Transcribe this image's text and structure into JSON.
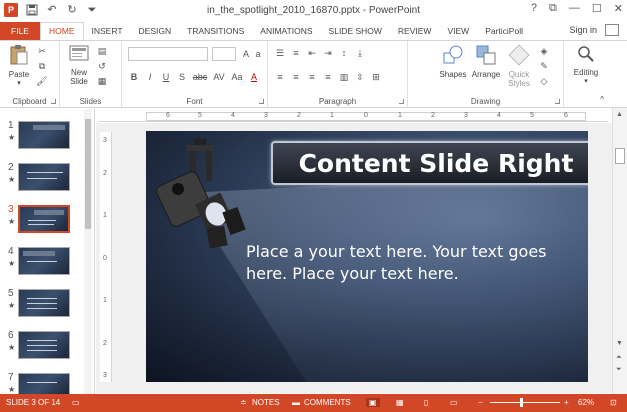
{
  "window": {
    "title": "in_the_spotlight_2010_16870.pptx - PowerPoint",
    "app_logo": "P",
    "controls": [
      "?",
      "⧉",
      "—",
      "☐",
      "✕"
    ]
  },
  "tabs": [
    "FILE",
    "HOME",
    "INSERT",
    "DESIGN",
    "TRANSITIONS",
    "ANIMATIONS",
    "SLIDE SHOW",
    "REVIEW",
    "VIEW",
    "ParticiPoll"
  ],
  "active_tab": "HOME",
  "signin": "Sign in",
  "ribbon": {
    "clipboard": {
      "label": "Clipboard",
      "paste": "Paste"
    },
    "slides": {
      "label": "Slides",
      "new_slide_1": "New",
      "new_slide_2": "Slide"
    },
    "font": {
      "label": "Font",
      "buttons": [
        "B",
        "I",
        "U",
        "S",
        "abc",
        "AV",
        "Aa",
        "A"
      ]
    },
    "paragraph": {
      "label": "Paragraph"
    },
    "drawing": {
      "label": "Drawing",
      "shapes": "Shapes",
      "arrange": "Arrange",
      "quick_styles_1": "Quick",
      "quick_styles_2": "Styles"
    },
    "editing": {
      "label": "Editing"
    }
  },
  "thumbnails": [
    {
      "num": "1",
      "star": "★"
    },
    {
      "num": "2",
      "star": "★"
    },
    {
      "num": "3",
      "star": "★"
    },
    {
      "num": "4",
      "star": "★"
    },
    {
      "num": "5",
      "star": "★"
    },
    {
      "num": "6",
      "star": "★"
    },
    {
      "num": "7",
      "star": "★"
    }
  ],
  "selected_slide": "3",
  "ruler": {
    "h": [
      "6",
      "5",
      "4",
      "3",
      "2",
      "1",
      "0",
      "1",
      "2",
      "3",
      "4",
      "5",
      "6"
    ],
    "v": [
      "3",
      "2",
      "1",
      "0",
      "1",
      "2",
      "3"
    ]
  },
  "slide": {
    "title": "Content Slide Right",
    "body": "Place a your text here.  Your text goes here. Place your text here."
  },
  "status": {
    "slide_info": "SLIDE 3 OF 14",
    "notes": "NOTES",
    "comments": "COMMENTS",
    "zoom": "62%"
  },
  "colors": {
    "accent": "#d24726",
    "slide_bg": "#2a3a55"
  }
}
